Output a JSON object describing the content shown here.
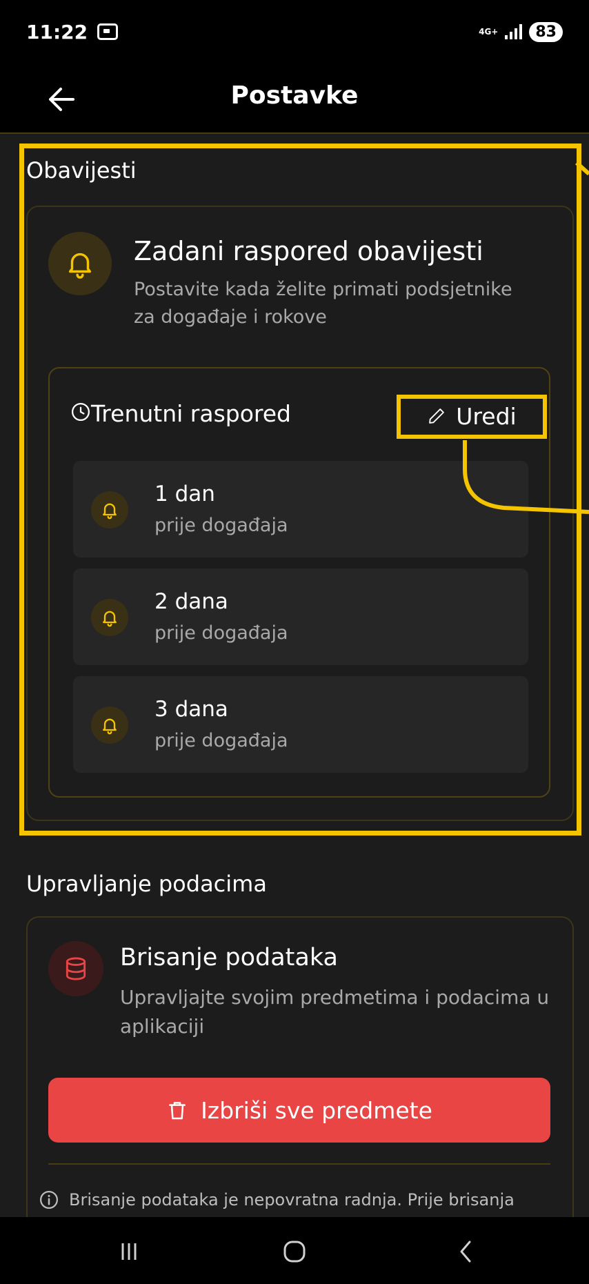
{
  "status_bar": {
    "time": "11:22",
    "network": "4G+",
    "battery": "83"
  },
  "app_bar": {
    "title": "Postavke",
    "back_icon": "arrow-left-icon"
  },
  "notifications": {
    "section_label": "Obavijesti",
    "card_title": "Zadani raspored obavijesti",
    "card_desc_line1": "Postavite kada želite primati podsjetnike",
    "card_desc_line2": "za događaje i rokove",
    "schedule": {
      "label": "Trenutni raspored",
      "edit_label": "Uredi",
      "reminders": [
        {
          "value": "1 dan",
          "sub": "prije događaja"
        },
        {
          "value": "2 dana",
          "sub": "prije događaja"
        },
        {
          "value": "3 dana",
          "sub": "prije događaja"
        }
      ]
    }
  },
  "data_management": {
    "section_label": "Upravljanje podacima",
    "card_title": "Brisanje podataka",
    "card_desc_line1": "Upravljajte svojim predmetima i podacima u",
    "card_desc_line2": "aplikaciji",
    "delete_button": "Izbriši sve predmete",
    "info_text": "Brisanje podataka je nepovratna radnja. Prije brisanja"
  },
  "colors": {
    "accent_gold": "#f5c400",
    "danger_red": "#e94545",
    "background": "#1c1c1c",
    "muted_text": "#a9a9a9"
  }
}
